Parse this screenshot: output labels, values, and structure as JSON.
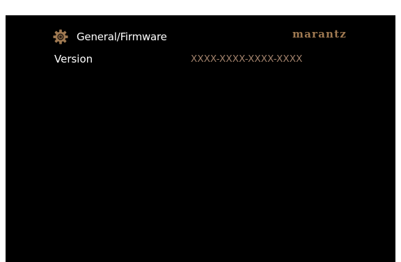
{
  "header": {
    "icon": "gear-icon",
    "title": "General/Firmware",
    "brand": "marantz",
    "brand_color": "#a07a52"
  },
  "firmware": {
    "version_label": "Version",
    "version_value": "XXXX-XXXX-XXXX-XXXX",
    "value_color": "#a0806a"
  },
  "colors": {
    "background": "#000000",
    "text": "#ffffff"
  }
}
